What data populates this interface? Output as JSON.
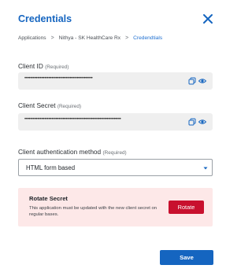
{
  "dialog": {
    "title": "Credentials",
    "close_icon": "close-icon"
  },
  "breadcrumb": {
    "items": [
      "Applications",
      "Nithya - SK HealthCare Rx",
      "Credendtials"
    ],
    "separator": ">"
  },
  "client_id": {
    "label": "Client ID",
    "required": "(Required)",
    "value": "••••••••••••••••••••••••••••••••••••••••••••••••",
    "icons": [
      "copy-icon",
      "eye-icon"
    ]
  },
  "client_secret": {
    "label": "Client Secret",
    "required": "(Required)",
    "value": "••••••••••••••••••••••••••••••••••••••••••••••••••••••••••••••••••••",
    "icons": [
      "copy-icon",
      "eye-icon"
    ]
  },
  "auth_method": {
    "label": "Client authentication method",
    "required": "(Required)",
    "selected": "HTML form based",
    "caret_icon": "chevron-down-icon"
  },
  "rotate": {
    "title": "Rotate Secret",
    "description": "This application must be updated with the new client secret on regular bases.",
    "button_label": "Rotate"
  },
  "footer": {
    "save_label": "Save"
  },
  "colors": {
    "accent": "#1565c0",
    "danger": "#c8102e",
    "danger_bg": "#fde8e8",
    "field_bg": "#efefef"
  }
}
